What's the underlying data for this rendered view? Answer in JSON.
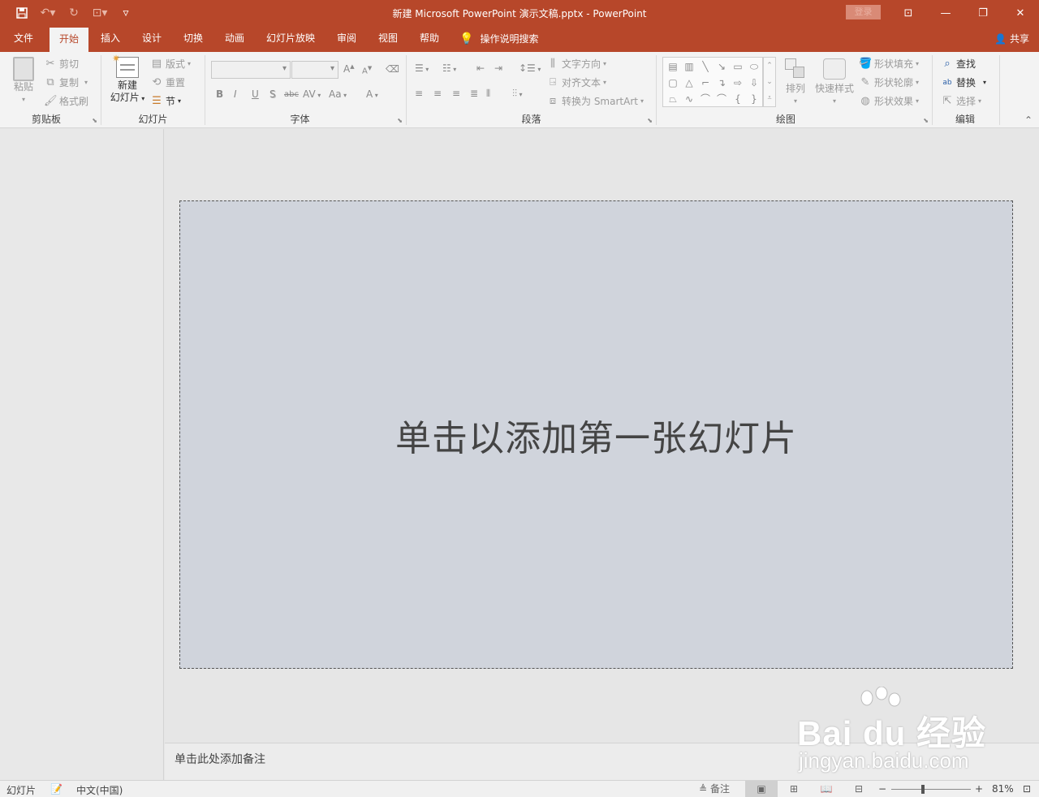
{
  "app": {
    "title": "新建 Microsoft PowerPoint 演示文稿.pptx  -  PowerPoint",
    "signin_label": "登录"
  },
  "qat": {
    "save_icon": "save-icon",
    "undo_icon": "undo-icon",
    "redo_icon": "redo-icon",
    "present_icon": "present-from-start-icon",
    "customize_icon": "customize-qat-icon"
  },
  "tabs": [
    {
      "label": "文件"
    },
    {
      "label": "开始"
    },
    {
      "label": "插入"
    },
    {
      "label": "设计"
    },
    {
      "label": "切换"
    },
    {
      "label": "动画"
    },
    {
      "label": "幻灯片放映"
    },
    {
      "label": "审阅"
    },
    {
      "label": "视图"
    },
    {
      "label": "帮助"
    }
  ],
  "tellme": {
    "label": "操作说明搜索"
  },
  "share": {
    "label": "共享"
  },
  "ribbon": {
    "clipboard": {
      "label": "剪贴板",
      "paste": "粘贴",
      "cut": "剪切",
      "copy": "复制",
      "format_painter": "格式刷"
    },
    "slides": {
      "label": "幻灯片",
      "new_slide_line1": "新建",
      "new_slide_line2": "幻灯片",
      "layout": "版式",
      "reset": "重置",
      "section": "节"
    },
    "font": {
      "label": "字体",
      "bold": "B",
      "italic": "I",
      "underline": "U",
      "shadow": "S",
      "strike": "abc",
      "spacing": "AV",
      "case": "Aa",
      "color": "A"
    },
    "paragraph": {
      "label": "段落",
      "text_direction": "文字方向",
      "align_text": "对齐文本",
      "smartart": "转换为 SmartArt"
    },
    "drawing": {
      "label": "绘图",
      "arrange": "排列",
      "quick_styles": "快速样式",
      "shape_fill": "形状填充",
      "shape_outline": "形状轮廓",
      "shape_effects": "形状效果"
    },
    "editing": {
      "label": "编辑",
      "find": "查找",
      "replace": "替换",
      "select": "选择"
    }
  },
  "slide": {
    "placeholder": "单击以添加第一张幻灯片"
  },
  "notes": {
    "placeholder": "单击此处添加备注"
  },
  "watermark": {
    "logo": "Bai  du 经验",
    "url": "jingyan.baidu.com"
  },
  "statusbar": {
    "slide_label": "幻灯片",
    "language": "中文(中国)",
    "notes_label": "备注",
    "zoom_minus": "−",
    "zoom_plus": "+",
    "zoom_percent": "81%",
    "zoom_value": 0.81
  }
}
